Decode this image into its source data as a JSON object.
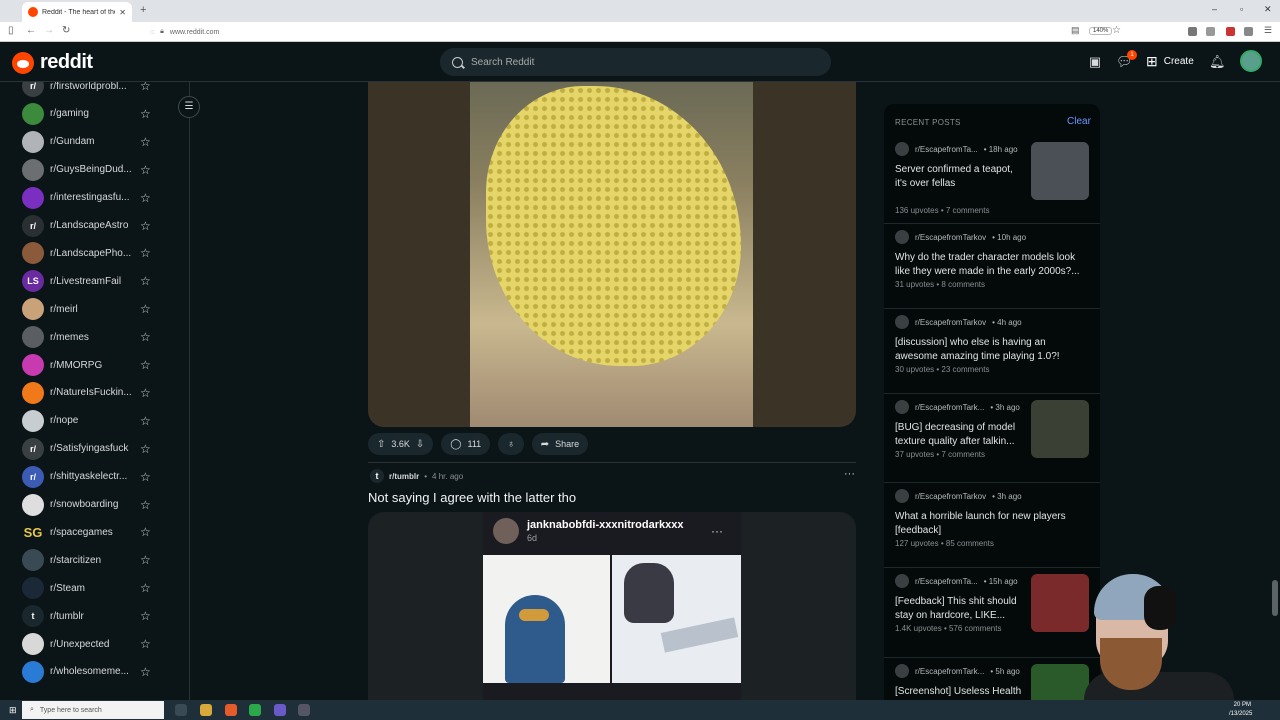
{
  "browser": {
    "tab_title": "Reddit - The heart of the intern",
    "new_tab": "+",
    "url": "www.reddit.com",
    "zoom": "140%",
    "minimize": "–",
    "maximize": "▫",
    "close": "✕"
  },
  "header": {
    "logo_text": "reddit",
    "search_placeholder": "Search Reddit",
    "chat_badge": "1",
    "create_label": "Create"
  },
  "sidebar": {
    "communities": [
      {
        "name": "r/firstworldprobl...",
        "avatar_text": "r/",
        "color": "#3a3f42"
      },
      {
        "name": "r/gaming",
        "avatar_text": "",
        "color": "#3c8a3c"
      },
      {
        "name": "r/Gundam",
        "avatar_text": "",
        "color": "#b0b4b8"
      },
      {
        "name": "r/GuysBeingDud...",
        "avatar_text": "",
        "color": "#6b6f72"
      },
      {
        "name": "r/interestingasfu...",
        "avatar_text": "",
        "color": "#7b2fc0"
      },
      {
        "name": "r/LandscapeAstro",
        "avatar_text": "r/",
        "color": "#2a2f33"
      },
      {
        "name": "r/LandscapePho...",
        "avatar_text": "",
        "color": "#8a5a3a"
      },
      {
        "name": "r/LivestreamFail",
        "avatar_text": "LS",
        "color": "#6a2aa0"
      },
      {
        "name": "r/meirl",
        "avatar_text": "",
        "color": "#c9a27a"
      },
      {
        "name": "r/memes",
        "avatar_text": "",
        "color": "#5a5e62"
      },
      {
        "name": "r/MMORPG",
        "avatar_text": "",
        "color": "#c83ab0"
      },
      {
        "name": "r/NatureIsFuckin...",
        "avatar_text": "",
        "color": "#f07a1a"
      },
      {
        "name": "r/nope",
        "avatar_text": "",
        "color": "#c8cdd2"
      },
      {
        "name": "r/Satisfyingasfuck",
        "avatar_text": "r/",
        "color": "#3a3f42"
      },
      {
        "name": "r/shittyaskelectr...",
        "avatar_text": "r/",
        "color": "#3b5bb5"
      },
      {
        "name": "r/snowboarding",
        "avatar_text": "",
        "color": "#dedede"
      },
      {
        "name": "r/spacegames",
        "avatar_text": "SG",
        "color": "#0b1416"
      },
      {
        "name": "r/starcitizen",
        "avatar_text": "",
        "color": "#3a4a55"
      },
      {
        "name": "r/Steam",
        "avatar_text": "",
        "color": "#1b2838"
      },
      {
        "name": "r/tumblr",
        "avatar_text": "t",
        "color": "#1a282d"
      },
      {
        "name": "r/Unexpected",
        "avatar_text": "",
        "color": "#d8d8d8"
      },
      {
        "name": "r/wholesomeme...",
        "avatar_text": "",
        "color": "#2a7bd6"
      }
    ],
    "star_glyph": "☆",
    "collapse_glyph": "☰"
  },
  "post1": {
    "votes": "3.6K",
    "comments": "111",
    "share_label": "Share"
  },
  "post2": {
    "subreddit": "r/tumblr",
    "separator": "•",
    "time": "4 hr. ago",
    "title": "Not saying I agree with the latter tho",
    "tumblr_user": "janknabobfdi-xxxnitrodarkxxx",
    "tumblr_age": "6d",
    "more_glyph": "···"
  },
  "recent": {
    "heading": "RECENT POSTS",
    "clear_label": "Clear",
    "posts": [
      {
        "sub": "r/EscapefromTa...",
        "time": "• 18h ago",
        "title_l1": "Server confirmed a teapot,",
        "title_l2": "it's over fellas",
        "upvotes": "136 upvotes",
        "comments": "7 comments",
        "thumb": "#4a5055"
      },
      {
        "sub": "r/EscapefromTarkov",
        "time": "• 10h ago",
        "title_l1": "Why do the trader character models look",
        "title_l2": "like they were made in the early 2000s?...",
        "upvotes": "31 upvotes",
        "comments": "8 comments",
        "thumb": ""
      },
      {
        "sub": "r/EscapefromTarkov",
        "time": "• 4h ago",
        "title_l1": "[discussion] who else is having an",
        "title_l2": "awesome amazing time playing 1.0?!",
        "upvotes": "30 upvotes",
        "comments": "23 comments",
        "thumb": ""
      },
      {
        "sub": "r/EscapefromTark...",
        "time": "• 3h ago",
        "title_l1": "[BUG] decreasing of model",
        "title_l2": "texture quality after talkin...",
        "upvotes": "37 upvotes",
        "comments": "7 comments",
        "thumb": "#3a4034"
      },
      {
        "sub": "r/EscapefromTarkov",
        "time": "• 3h ago",
        "title_l1": "What a horrible launch for new players",
        "title_l2": "[feedback]",
        "upvotes": "127 upvotes",
        "comments": "85 comments",
        "thumb": ""
      },
      {
        "sub": "r/EscapefromTa...",
        "time": "• 15h ago",
        "title_l1": "[Feedback] This shit should",
        "title_l2": "stay on hardcore, LIKE...",
        "upvotes": "1.4K upvotes",
        "comments": "576 comments",
        "thumb": "#7a2a2a"
      },
      {
        "sub": "r/EscapefromTark...",
        "time": "• 5h ago",
        "title_l1": "[Screenshot] Useless Health",
        "title_l2": "",
        "upvotes": "",
        "comments": "",
        "thumb": "#2a5a2a"
      }
    ],
    "stats_sep": "•"
  },
  "taskbar": {
    "search_placeholder": "Type here to search",
    "clock_time": "20 PM",
    "clock_date": "/13/2025"
  }
}
